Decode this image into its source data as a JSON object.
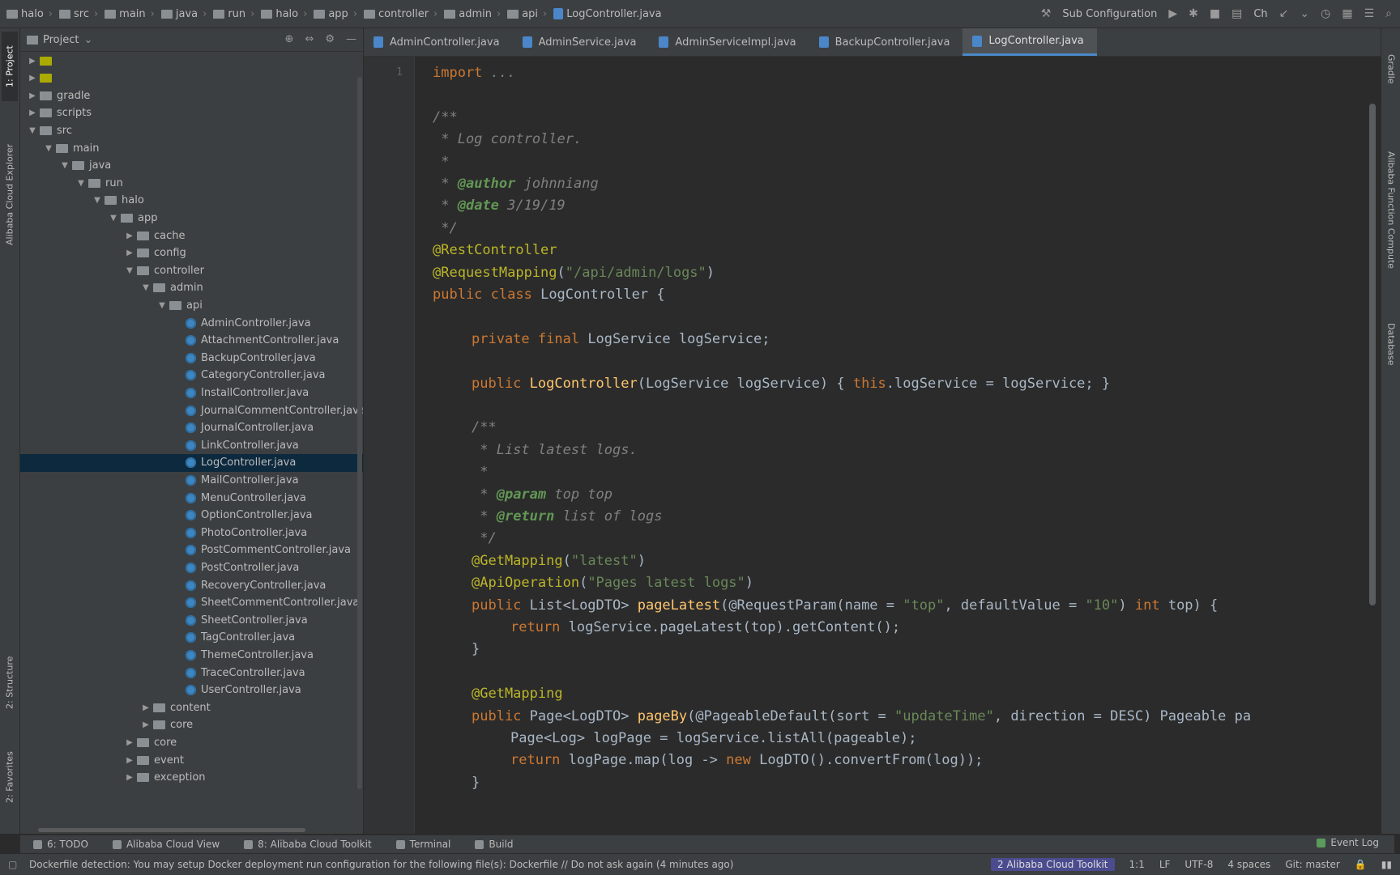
{
  "navbar": {
    "breadcrumbs": [
      "halo",
      "src",
      "main",
      "java",
      "run",
      "halo",
      "app",
      "controller",
      "admin",
      "api",
      "LogController.java"
    ],
    "run_config": "Sub Configuration",
    "run_config_extra": "Ch"
  },
  "left_stripe": {
    "tabs": [
      "1: Project",
      "Alibaba Cloud Explorer",
      "2: Structure",
      "2: Favorites"
    ]
  },
  "right_stripe": {
    "tabs": [
      "Gradle",
      "Alibaba Function Compute",
      "Database"
    ]
  },
  "project": {
    "title": "Project",
    "tree": [
      {
        "label": "",
        "type": "folder",
        "indent": 0,
        "arrow": "▶",
        "color": "#aaaa00"
      },
      {
        "label": "",
        "type": "folder",
        "indent": 0,
        "arrow": "▶",
        "color": "#aaaa00"
      },
      {
        "label": "gradle",
        "type": "folder",
        "indent": 0,
        "arrow": "▶"
      },
      {
        "label": "scripts",
        "type": "folder",
        "indent": 0,
        "arrow": "▶"
      },
      {
        "label": "src",
        "type": "folder",
        "indent": 0,
        "arrow": "▼"
      },
      {
        "label": "main",
        "type": "folder",
        "indent": 1,
        "arrow": "▼"
      },
      {
        "label": "java",
        "type": "folder",
        "indent": 2,
        "arrow": "▼"
      },
      {
        "label": "run",
        "type": "folder",
        "indent": 3,
        "arrow": "▼"
      },
      {
        "label": "halo",
        "type": "folder",
        "indent": 4,
        "arrow": "▼"
      },
      {
        "label": "app",
        "type": "folder",
        "indent": 5,
        "arrow": "▼"
      },
      {
        "label": "cache",
        "type": "folder",
        "indent": 6,
        "arrow": "▶"
      },
      {
        "label": "config",
        "type": "folder",
        "indent": 6,
        "arrow": "▶"
      },
      {
        "label": "controller",
        "type": "folder",
        "indent": 6,
        "arrow": "▼"
      },
      {
        "label": "admin",
        "type": "folder",
        "indent": 7,
        "arrow": "▼"
      },
      {
        "label": "api",
        "type": "folder",
        "indent": 8,
        "arrow": "▼"
      },
      {
        "label": "AdminController.java",
        "type": "class",
        "indent": 9,
        "arrow": ""
      },
      {
        "label": "AttachmentController.java",
        "type": "class",
        "indent": 9,
        "arrow": ""
      },
      {
        "label": "BackupController.java",
        "type": "class",
        "indent": 9,
        "arrow": ""
      },
      {
        "label": "CategoryController.java",
        "type": "class",
        "indent": 9,
        "arrow": ""
      },
      {
        "label": "InstallController.java",
        "type": "class",
        "indent": 9,
        "arrow": ""
      },
      {
        "label": "JournalCommentController.java",
        "type": "class",
        "indent": 9,
        "arrow": ""
      },
      {
        "label": "JournalController.java",
        "type": "class",
        "indent": 9,
        "arrow": ""
      },
      {
        "label": "LinkController.java",
        "type": "class",
        "indent": 9,
        "arrow": ""
      },
      {
        "label": "LogController.java",
        "type": "class",
        "indent": 9,
        "arrow": "",
        "selected": true
      },
      {
        "label": "MailController.java",
        "type": "class",
        "indent": 9,
        "arrow": ""
      },
      {
        "label": "MenuController.java",
        "type": "class",
        "indent": 9,
        "arrow": ""
      },
      {
        "label": "OptionController.java",
        "type": "class",
        "indent": 9,
        "arrow": ""
      },
      {
        "label": "PhotoController.java",
        "type": "class",
        "indent": 9,
        "arrow": ""
      },
      {
        "label": "PostCommentController.java",
        "type": "class",
        "indent": 9,
        "arrow": ""
      },
      {
        "label": "PostController.java",
        "type": "class",
        "indent": 9,
        "arrow": ""
      },
      {
        "label": "RecoveryController.java",
        "type": "class",
        "indent": 9,
        "arrow": ""
      },
      {
        "label": "SheetCommentController.java",
        "type": "class",
        "indent": 9,
        "arrow": ""
      },
      {
        "label": "SheetController.java",
        "type": "class",
        "indent": 9,
        "arrow": ""
      },
      {
        "label": "TagController.java",
        "type": "class",
        "indent": 9,
        "arrow": ""
      },
      {
        "label": "ThemeController.java",
        "type": "class",
        "indent": 9,
        "arrow": ""
      },
      {
        "label": "TraceController.java",
        "type": "class",
        "indent": 9,
        "arrow": ""
      },
      {
        "label": "UserController.java",
        "type": "class",
        "indent": 9,
        "arrow": ""
      },
      {
        "label": "content",
        "type": "folder",
        "indent": 7,
        "arrow": "▶"
      },
      {
        "label": "core",
        "type": "folder",
        "indent": 7,
        "arrow": "▶"
      },
      {
        "label": "core",
        "type": "folder",
        "indent": 6,
        "arrow": "▶"
      },
      {
        "label": "event",
        "type": "folder",
        "indent": 6,
        "arrow": "▶"
      },
      {
        "label": "exception",
        "type": "folder",
        "indent": 6,
        "arrow": "▶"
      }
    ]
  },
  "editor_tabs": [
    {
      "label": "AdminController.java",
      "active": false
    },
    {
      "label": "AdminService.java",
      "active": false
    },
    {
      "label": "AdminServiceImpl.java",
      "active": false
    },
    {
      "label": "BackupController.java",
      "active": false
    },
    {
      "label": "LogController.java",
      "active": true
    }
  ],
  "line_numbers": [
    "1",
    "",
    "",
    "",
    "",
    "",
    "",
    "",
    "",
    "",
    "",
    "",
    "",
    "",
    "",
    "",
    "",
    "",
    "",
    "",
    "",
    "",
    "",
    "",
    "",
    "",
    "",
    "",
    "",
    "",
    "",
    "",
    "",
    ""
  ],
  "code_lines": [
    {
      "row": 0,
      "indent": 0,
      "tokens": [
        {
          "t": "import",
          "c": "kw"
        },
        {
          "t": " ...",
          "c": "com"
        }
      ]
    },
    {
      "row": 2,
      "indent": 0,
      "tokens": [
        {
          "t": "/**",
          "c": "com"
        }
      ]
    },
    {
      "row": 3,
      "indent": 0,
      "tokens": [
        {
          "t": " * Log controller.",
          "c": "com"
        }
      ]
    },
    {
      "row": 4,
      "indent": 0,
      "tokens": [
        {
          "t": " *",
          "c": "com"
        }
      ]
    },
    {
      "row": 5,
      "indent": 0,
      "tokens": [
        {
          "t": " * ",
          "c": "com"
        },
        {
          "t": "@author",
          "c": "tag"
        },
        {
          "t": " johnniang",
          "c": "com"
        }
      ]
    },
    {
      "row": 6,
      "indent": 0,
      "tokens": [
        {
          "t": " * ",
          "c": "com"
        },
        {
          "t": "@date",
          "c": "tag"
        },
        {
          "t": " 3/19/19",
          "c": "com"
        }
      ]
    },
    {
      "row": 7,
      "indent": 0,
      "tokens": [
        {
          "t": " */",
          "c": "com"
        }
      ]
    },
    {
      "row": 8,
      "indent": 0,
      "tokens": [
        {
          "t": "@RestController",
          "c": "ann"
        }
      ]
    },
    {
      "row": 9,
      "indent": 0,
      "tokens": [
        {
          "t": "@RequestMapping",
          "c": "ann"
        },
        {
          "t": "(",
          "c": ""
        },
        {
          "t": "\"/api/admin/logs\"",
          "c": "str"
        },
        {
          "t": ")",
          "c": ""
        }
      ]
    },
    {
      "row": 10,
      "indent": 0,
      "tokens": [
        {
          "t": "public ",
          "c": "kw"
        },
        {
          "t": "class ",
          "c": "kw"
        },
        {
          "t": "LogController {",
          "c": ""
        }
      ]
    },
    {
      "row": 12,
      "indent": 1,
      "tokens": [
        {
          "t": "private ",
          "c": "kw"
        },
        {
          "t": "final ",
          "c": "kw"
        },
        {
          "t": "LogService logService;",
          "c": ""
        }
      ]
    },
    {
      "row": 14,
      "indent": 1,
      "tokens": [
        {
          "t": "public ",
          "c": "kw"
        },
        {
          "t": "LogController",
          "c": "fn"
        },
        {
          "t": "(LogService logService) { ",
          "c": ""
        },
        {
          "t": "this",
          "c": "kw"
        },
        {
          "t": ".logService = logService; }",
          "c": ""
        }
      ]
    },
    {
      "row": 16,
      "indent": 1,
      "tokens": [
        {
          "t": "/**",
          "c": "com"
        }
      ]
    },
    {
      "row": 17,
      "indent": 1,
      "tokens": [
        {
          "t": " * List latest logs.",
          "c": "com"
        }
      ]
    },
    {
      "row": 18,
      "indent": 1,
      "tokens": [
        {
          "t": " *",
          "c": "com"
        }
      ]
    },
    {
      "row": 19,
      "indent": 1,
      "tokens": [
        {
          "t": " * ",
          "c": "com"
        },
        {
          "t": "@param",
          "c": "tag"
        },
        {
          "t": " top top",
          "c": "com"
        }
      ]
    },
    {
      "row": 20,
      "indent": 1,
      "tokens": [
        {
          "t": " * ",
          "c": "com"
        },
        {
          "t": "@return",
          "c": "tag"
        },
        {
          "t": " list of logs",
          "c": "com"
        }
      ]
    },
    {
      "row": 21,
      "indent": 1,
      "tokens": [
        {
          "t": " */",
          "c": "com"
        }
      ]
    },
    {
      "row": 22,
      "indent": 1,
      "tokens": [
        {
          "t": "@GetMapping",
          "c": "ann"
        },
        {
          "t": "(",
          "c": ""
        },
        {
          "t": "\"latest\"",
          "c": "str"
        },
        {
          "t": ")",
          "c": ""
        }
      ]
    },
    {
      "row": 23,
      "indent": 1,
      "tokens": [
        {
          "t": "@ApiOperation",
          "c": "ann"
        },
        {
          "t": "(",
          "c": ""
        },
        {
          "t": "\"Pages latest logs\"",
          "c": "str"
        },
        {
          "t": ")",
          "c": ""
        }
      ]
    },
    {
      "row": 24,
      "indent": 1,
      "tokens": [
        {
          "t": "public ",
          "c": "kw"
        },
        {
          "t": "List<LogDTO> ",
          "c": ""
        },
        {
          "t": "pageLatest",
          "c": "fn"
        },
        {
          "t": "(@RequestParam(name = ",
          "c": ""
        },
        {
          "t": "\"top\"",
          "c": "str"
        },
        {
          "t": ", defaultValue = ",
          "c": ""
        },
        {
          "t": "\"10\"",
          "c": "str"
        },
        {
          "t": ") ",
          "c": ""
        },
        {
          "t": "int ",
          "c": "kw"
        },
        {
          "t": "top) {",
          "c": ""
        }
      ]
    },
    {
      "row": 25,
      "indent": 2,
      "tokens": [
        {
          "t": "return ",
          "c": "kw"
        },
        {
          "t": "logService.pageLatest(top).getContent();",
          "c": ""
        }
      ]
    },
    {
      "row": 26,
      "indent": 1,
      "tokens": [
        {
          "t": "}",
          "c": ""
        }
      ]
    },
    {
      "row": 28,
      "indent": 1,
      "tokens": [
        {
          "t": "@GetMapping",
          "c": "ann"
        }
      ]
    },
    {
      "row": 29,
      "indent": 1,
      "tokens": [
        {
          "t": "public ",
          "c": "kw"
        },
        {
          "t": "Page<LogDTO> ",
          "c": ""
        },
        {
          "t": "pageBy",
          "c": "fn"
        },
        {
          "t": "(@PageableDefault(sort = ",
          "c": ""
        },
        {
          "t": "\"updateTime\"",
          "c": "str"
        },
        {
          "t": ", direction = DESC) Pageable pa",
          "c": ""
        }
      ]
    },
    {
      "row": 30,
      "indent": 2,
      "tokens": [
        {
          "t": "Page<Log> logPage = logService.listAll(pageable);",
          "c": ""
        }
      ]
    },
    {
      "row": 31,
      "indent": 2,
      "tokens": [
        {
          "t": "return ",
          "c": "kw"
        },
        {
          "t": "logPage.map(log -> ",
          "c": ""
        },
        {
          "t": "new ",
          "c": "kw"
        },
        {
          "t": "LogDTO().convertFrom(log));",
          "c": ""
        }
      ]
    },
    {
      "row": 32,
      "indent": 1,
      "tokens": [
        {
          "t": "}",
          "c": ""
        }
      ]
    }
  ],
  "bottom_tabs": [
    "6: TODO",
    "Alibaba Cloud View",
    "8: Alibaba Cloud Toolkit",
    "Terminal",
    "Build"
  ],
  "event_log": "Event Log",
  "status": {
    "message": "Dockerfile detection: You may setup Docker deployment run configuration for the following file(s): Dockerfile // Do not ask again (4 minutes ago)",
    "git": "2 Alibaba Cloud Toolkit",
    "position": "1:1",
    "lf": "LF",
    "encoding": "UTF-8",
    "indent": "4 spaces",
    "branch": "Git: master"
  }
}
